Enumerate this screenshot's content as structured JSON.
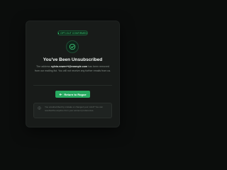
{
  "badge": {
    "label": "OPT-OUT CONFIRMED"
  },
  "title": "You've Been Unsubscribed",
  "description": {
    "prefix": "The address ",
    "email": "sylvia.rowen+t@example.com",
    "suffix": " has been removed from our mailing list. You will not receive any further emails from us."
  },
  "button": {
    "label": "Return to Rogue"
  },
  "note": {
    "text": "You unsubscribed by mistake or changed your mind? You can resubscribe anytime from your account preferences."
  },
  "colors": {
    "accent": "#27a960",
    "card": "#181b19",
    "background": "#0b0d0c"
  },
  "icons": {
    "main": "check-circle-icon",
    "button": "arrow-left-icon",
    "note": "info-icon"
  }
}
